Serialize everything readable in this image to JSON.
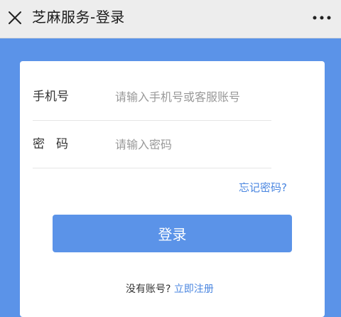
{
  "header": {
    "title": "芝麻服务-登录",
    "close_icon": "close-icon",
    "more_icon": "more-icon"
  },
  "form": {
    "phone": {
      "label": "手机号",
      "value": "",
      "placeholder": "请输入手机号或客服账号"
    },
    "password": {
      "label": "密码",
      "value": "",
      "placeholder": "请输入密码"
    },
    "forgot_link": "忘记密码?",
    "login_button": "登录"
  },
  "footer": {
    "no_account_text": "没有账号?",
    "register_link": "立即注册"
  },
  "colors": {
    "accent": "#5b93e8",
    "link": "#4a86e0",
    "titlebar_bg": "#ededed"
  }
}
